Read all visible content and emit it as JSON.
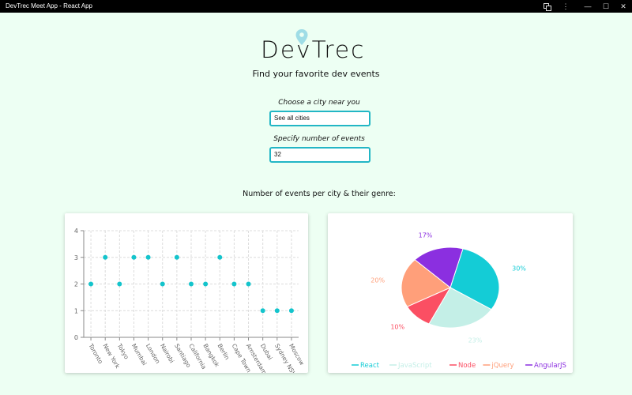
{
  "window": {
    "title": "DevTrec Meet App - React App",
    "icons": [
      "translate-icon",
      "more-vertical-icon",
      "minimize-icon",
      "maximize-icon",
      "close-icon"
    ]
  },
  "header": {
    "logo_text": "DevTrec",
    "tagline": "Find your favorite dev events"
  },
  "form": {
    "city_label": "Choose a city near you",
    "city_value": "See all cities",
    "count_label": "Specify number of events",
    "count_value": "32"
  },
  "charts_title": "Number of events per city & their genre:",
  "colors": {
    "background": "#edfff3",
    "accent": "#22b6c5",
    "scatter_dot": "#14c4cc"
  },
  "chart_data": [
    {
      "type": "scatter",
      "categories": [
        "Toronto",
        "New York",
        "Tokyo",
        "Mumbai",
        "London",
        "Nairobi",
        "Santiago",
        "California",
        "Bangkok",
        "Berlin",
        "Cape Town",
        "Amsterdam",
        "Dubai",
        "Sydney NSW",
        "Moscow"
      ],
      "values": [
        2,
        3,
        2,
        3,
        3,
        2,
        3,
        2,
        2,
        3,
        2,
        2,
        1,
        1,
        1
      ],
      "ylim": [
        0,
        4
      ],
      "yticks": [
        0,
        1,
        2,
        3,
        4
      ],
      "grid": true,
      "color": "#14c4cc"
    },
    {
      "type": "pie",
      "slices": [
        {
          "name": "React",
          "value": 30,
          "label": "30%",
          "color": "#14ccd6"
        },
        {
          "name": "JavaScript",
          "value": 23,
          "label": "23%",
          "color": "#c4efe7"
        },
        {
          "name": "Node",
          "value": 10,
          "label": "10%",
          "color": "#fb4f63"
        },
        {
          "name": "jQuery",
          "value": 20,
          "label": "20%",
          "color": "#ff9f7a"
        },
        {
          "name": "AngularJS",
          "value": 17,
          "label": "17%",
          "color": "#8b2fe0"
        }
      ],
      "legend": "bottom"
    }
  ]
}
